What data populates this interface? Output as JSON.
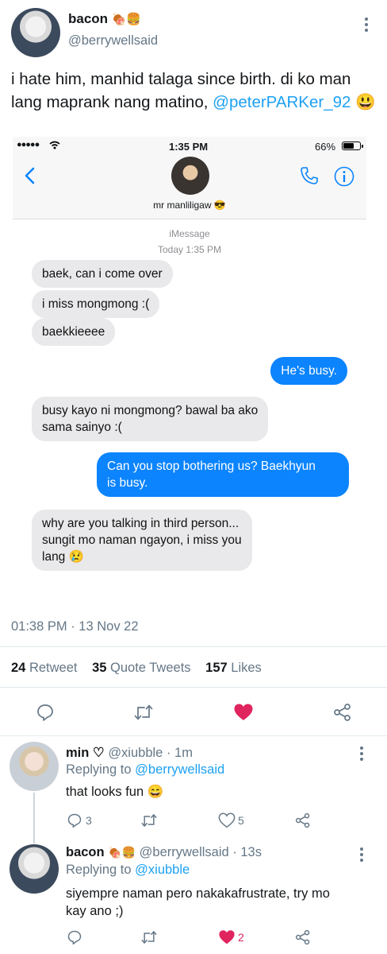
{
  "tweet": {
    "author_name": "bacon",
    "author_emoji": "🍖🍔",
    "author_handle": "@berrywellsaid",
    "text": "i hate him, manhid talaga since birth. di ko man lang maprank nang matino,",
    "mention": "@peterPARKer_92",
    "text_emoji": "😃",
    "timestamp": "01:38 PM · 13 Nov 22",
    "stats": {
      "retweets_count": "24",
      "retweets_label": "Retweet",
      "quotes_count": "35",
      "quotes_label": "Quote Tweets",
      "likes_count": "157",
      "likes_label": "Likes"
    }
  },
  "screenshot": {
    "carrier": "●●●●●",
    "time": "1:35 PM",
    "battery": "66%",
    "contact_name": "mr manliligaw",
    "contact_emoji": "😎",
    "service": "iMessage",
    "date": "Today 1:35 PM",
    "messages": [
      {
        "from": "them",
        "text": "baek, can i come over"
      },
      {
        "from": "them",
        "text": "i miss mongmong :("
      },
      {
        "from": "them",
        "text": "baekkieeee"
      },
      {
        "from": "me",
        "text": "He's busy."
      },
      {
        "from": "them",
        "line1": "busy kayo ni mongmong? bawal ba ako",
        "line2": "sama sainyo :("
      },
      {
        "from": "me",
        "line1": "Can you stop bothering us? Baekhyun",
        "line2": "is busy."
      },
      {
        "from": "them",
        "line1": "why are you talking in third person...",
        "line2": "sungit mo naman ngayon, i miss you",
        "line3": "lang 😢"
      }
    ]
  },
  "replies": [
    {
      "name": "min ♡",
      "handle": "@xiubble",
      "time": "· 1m",
      "replying_prefix": "Replying to",
      "replying_to": "@berrywellsaid",
      "text": "that looks fun 😄",
      "reply_count": "3",
      "like_count": "5"
    },
    {
      "name": "bacon",
      "name_emoji": "🍖🍔",
      "handle": "@berrywellsaid",
      "time": "· 13s",
      "replying_prefix": "Replying to",
      "replying_to": "@xiubble",
      "text_line1": "siyempre naman pero nakakafrustrate, try mo",
      "text_line2": "kay ano ;)",
      "like_count": "2"
    }
  ],
  "colors": {
    "accent": "#1da1f2",
    "like": "#e0245e",
    "imessage_blue": "#0b84fe",
    "bubble_gray": "#e9e9eb",
    "muted": "#657786"
  }
}
